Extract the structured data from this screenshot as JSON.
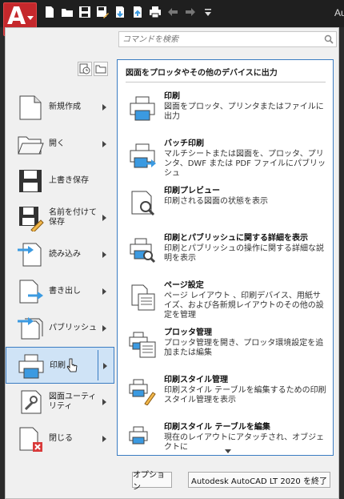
{
  "app": {
    "logo_letter": "A",
    "logo_sub": "LT",
    "title_fragment": "Au"
  },
  "search": {
    "placeholder": "コマンドを検索"
  },
  "left_menu": [
    {
      "label": "新規作成",
      "icon": "new-document-icon",
      "has_arrow": true
    },
    {
      "label": "開く",
      "icon": "open-folder-icon",
      "has_arrow": true
    },
    {
      "label": "上書き保存",
      "icon": "save-disk-icon",
      "has_arrow": false
    },
    {
      "label": "名前を付けて保存",
      "icon": "save-as-icon",
      "has_arrow": true
    },
    {
      "label": "読み込み",
      "icon": "import-icon",
      "has_arrow": true
    },
    {
      "label": "書き出し",
      "icon": "export-icon",
      "has_arrow": true
    },
    {
      "label": "パブリッシュ",
      "icon": "publish-icon",
      "has_arrow": true
    },
    {
      "label": "印刷",
      "icon": "print-icon",
      "has_arrow": true,
      "active": true
    },
    {
      "label": "図面ユーティリティ",
      "icon": "drawing-utilities-icon",
      "has_arrow": true
    },
    {
      "label": "閉じる",
      "icon": "close-document-icon",
      "has_arrow": true
    }
  ],
  "submenu": {
    "heading": "図面をプロッタやその他のデバイスに出力",
    "items": [
      {
        "title": "印刷",
        "desc": "図面をプロッタ、プリンタまたはファイルに出力",
        "icon": "plot-icon"
      },
      {
        "title": "バッチ印刷",
        "desc": "マルチシートまたは図面を、プロッタ、プリンタ、DWF または PDF ファイルにパブリッシュ",
        "icon": "batch-plot-icon"
      },
      {
        "title": "印刷プレビュー",
        "desc": "印刷される図面の状態を表示",
        "icon": "plot-preview-icon"
      },
      {
        "title": "印刷とパブリッシュに関する詳細を表示",
        "desc": "印刷とパブリッシュの操作に関する詳細な説明を表示",
        "icon": "plot-details-icon"
      },
      {
        "title": "ページ設定",
        "desc": "ページ レイアウト 、印刷デバイス、用紙サイズ、および各新規レイアウトのその他の設定を管理",
        "icon": "page-setup-icon"
      },
      {
        "title": "プロッタ管理",
        "desc": "プロッタ管理を開き、プロッタ環境設定を追加または編集",
        "icon": "plotter-manager-icon"
      },
      {
        "title": "印刷スタイル管理",
        "desc": "印刷スタイル テーブルを編集するための印刷スタイル管理を表示",
        "icon": "plot-style-manager-icon"
      },
      {
        "title": "印刷スタイル テーブルを編集",
        "desc": "現在のレイアウトにアタッチされ、オブジェクトに",
        "icon": "edit-plot-style-icon"
      }
    ]
  },
  "buttons": {
    "options": "オプション",
    "exit": "Autodesk AutoCAD LT 2020 を終了"
  },
  "colors": {
    "accent": "#3a7cc2",
    "app_red": "#c5282c",
    "printer_blue": "#3b9ae1"
  }
}
